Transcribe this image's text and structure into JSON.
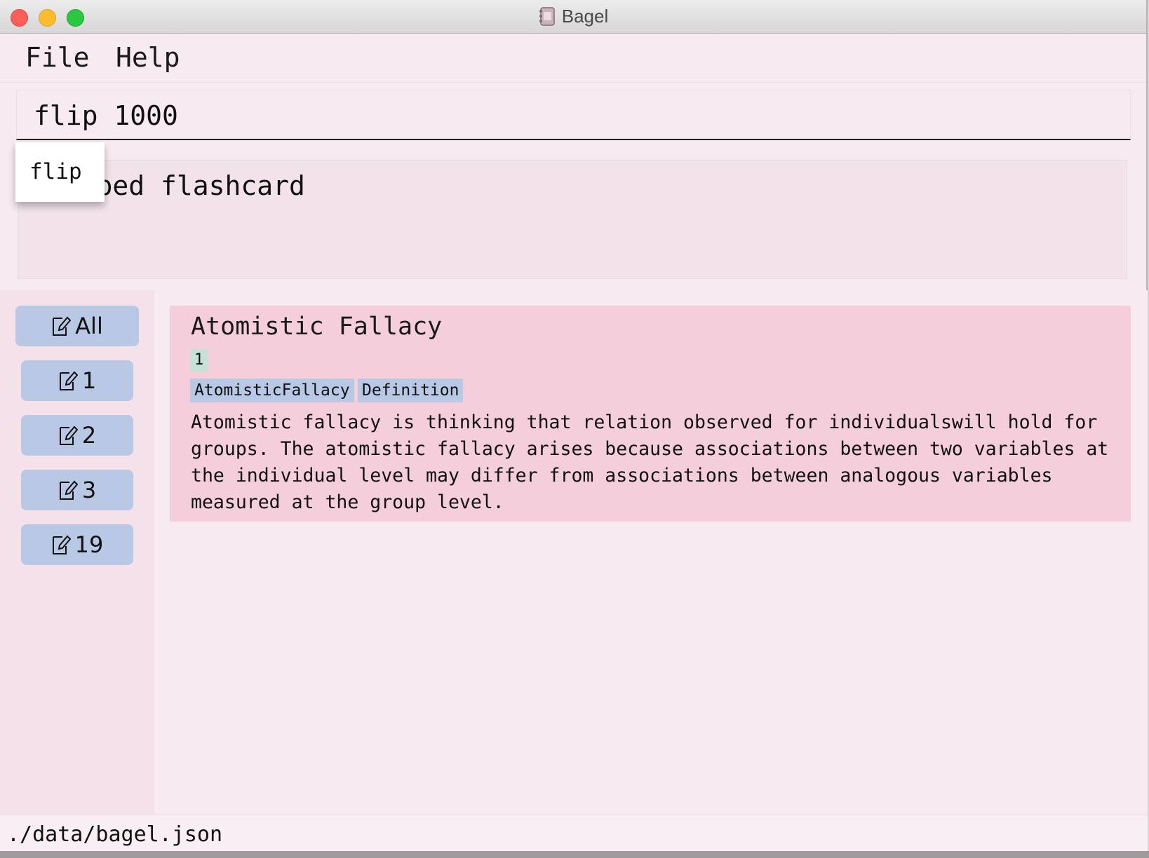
{
  "window": {
    "title": "Bagel"
  },
  "menu": {
    "file": "File",
    "help": "Help"
  },
  "command": {
    "value": "flip 1000"
  },
  "result": {
    "text": "Flipped flashcard"
  },
  "autocomplete": {
    "suggestion": "flip"
  },
  "sidebar": {
    "items": [
      {
        "label": "All",
        "selected": true
      },
      {
        "label": "1"
      },
      {
        "label": "2"
      },
      {
        "label": "3"
      },
      {
        "label": "19"
      }
    ]
  },
  "flashcard": {
    "title": "Atomistic Fallacy",
    "index_badge": "1",
    "tags": [
      "AtomisticFallacy",
      "Definition"
    ],
    "body": "Atomistic fallacy is thinking that relation observed for individualswill hold for groups. The atomistic fallacy arises because associations between two variables at the individual level may differ from associations between analogous variables measured at the group level."
  },
  "status": {
    "path": "./data/bagel.json"
  },
  "colors": {
    "background": "#f7eaf0",
    "card": "#f4cfdb",
    "tag": "#b9c8e5",
    "badge": "#c4e2d7",
    "sidebar_button": "#b9c8e5"
  }
}
